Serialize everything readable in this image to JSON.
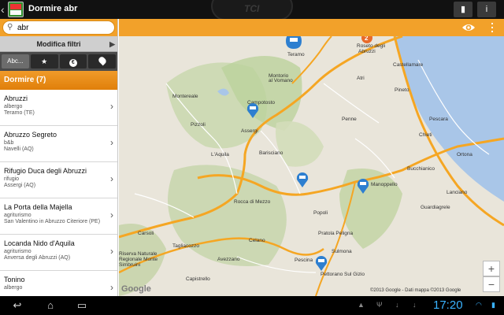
{
  "app": {
    "title": "Dormire abr",
    "brand": "TCI"
  },
  "actions": [
    {
      "icon": "book-icon",
      "glyph": "▮"
    },
    {
      "icon": "info-icon",
      "glyph": "i"
    }
  ],
  "search": {
    "value": "abr",
    "placeholder": ""
  },
  "filter": {
    "label": "Modifica filtri"
  },
  "tabs": [
    {
      "label": "Abc...",
      "icon": "alpha-sort-icon"
    },
    {
      "label": "★",
      "icon": "star-icon"
    },
    {
      "label": "€",
      "icon": "euro-icon"
    },
    {
      "label": "⬤",
      "icon": "location-icon"
    }
  ],
  "list": {
    "header": "Dormire (7)",
    "items": [
      {
        "name": "Abruzzi",
        "type": "albergo",
        "loc": "Teramo (TE)"
      },
      {
        "name": "Abruzzo Segreto",
        "type": "b&b",
        "loc": "Navelli (AQ)"
      },
      {
        "name": "Rifugio Duca degli Abruzzi",
        "type": "rifugio",
        "loc": "Assergi (AQ)"
      },
      {
        "name": "La Porta della Majella",
        "type": "agriturismo",
        "loc": "San Valentino in Abruzzo Citeriore (PE)"
      },
      {
        "name": "Locanda Nido d'Aquila",
        "type": "agriturismo",
        "loc": "Anversa degli Abruzzi (AQ)"
      },
      {
        "name": "Tonino",
        "type": "albergo",
        "loc": ""
      }
    ]
  },
  "map": {
    "cluster_count": "2",
    "towns": [
      "Teramo",
      "Roseto degli Abruzzi",
      "Montorio al Vomano",
      "Atri",
      "Montereale",
      "Pineto",
      "Penne",
      "Pescara",
      "Pizzoli",
      "Assergi",
      "Chieti",
      "Ortona",
      "L'Aquila",
      "Barisciano",
      "Bucchianico",
      "Lanciano",
      "Manoppello",
      "Guardiagrele",
      "Rocca di Mezzo",
      "Popoli",
      "Pratola Peligna",
      "Sulmona",
      "Carsoli",
      "Tagliacozzo",
      "Celano",
      "Avezzano",
      "Pescina",
      "Capistrello",
      "Pettorano Sul Gizio",
      "Riserva Naturale Regionale Monte Simbruini",
      "Campotosto",
      "Castellamare"
    ],
    "attribution": "©2013 Google - Dati mappa ©2013 Google",
    "google": "Google",
    "zoom_in": "+",
    "zoom_out": "−"
  },
  "system": {
    "time": "17:20"
  }
}
